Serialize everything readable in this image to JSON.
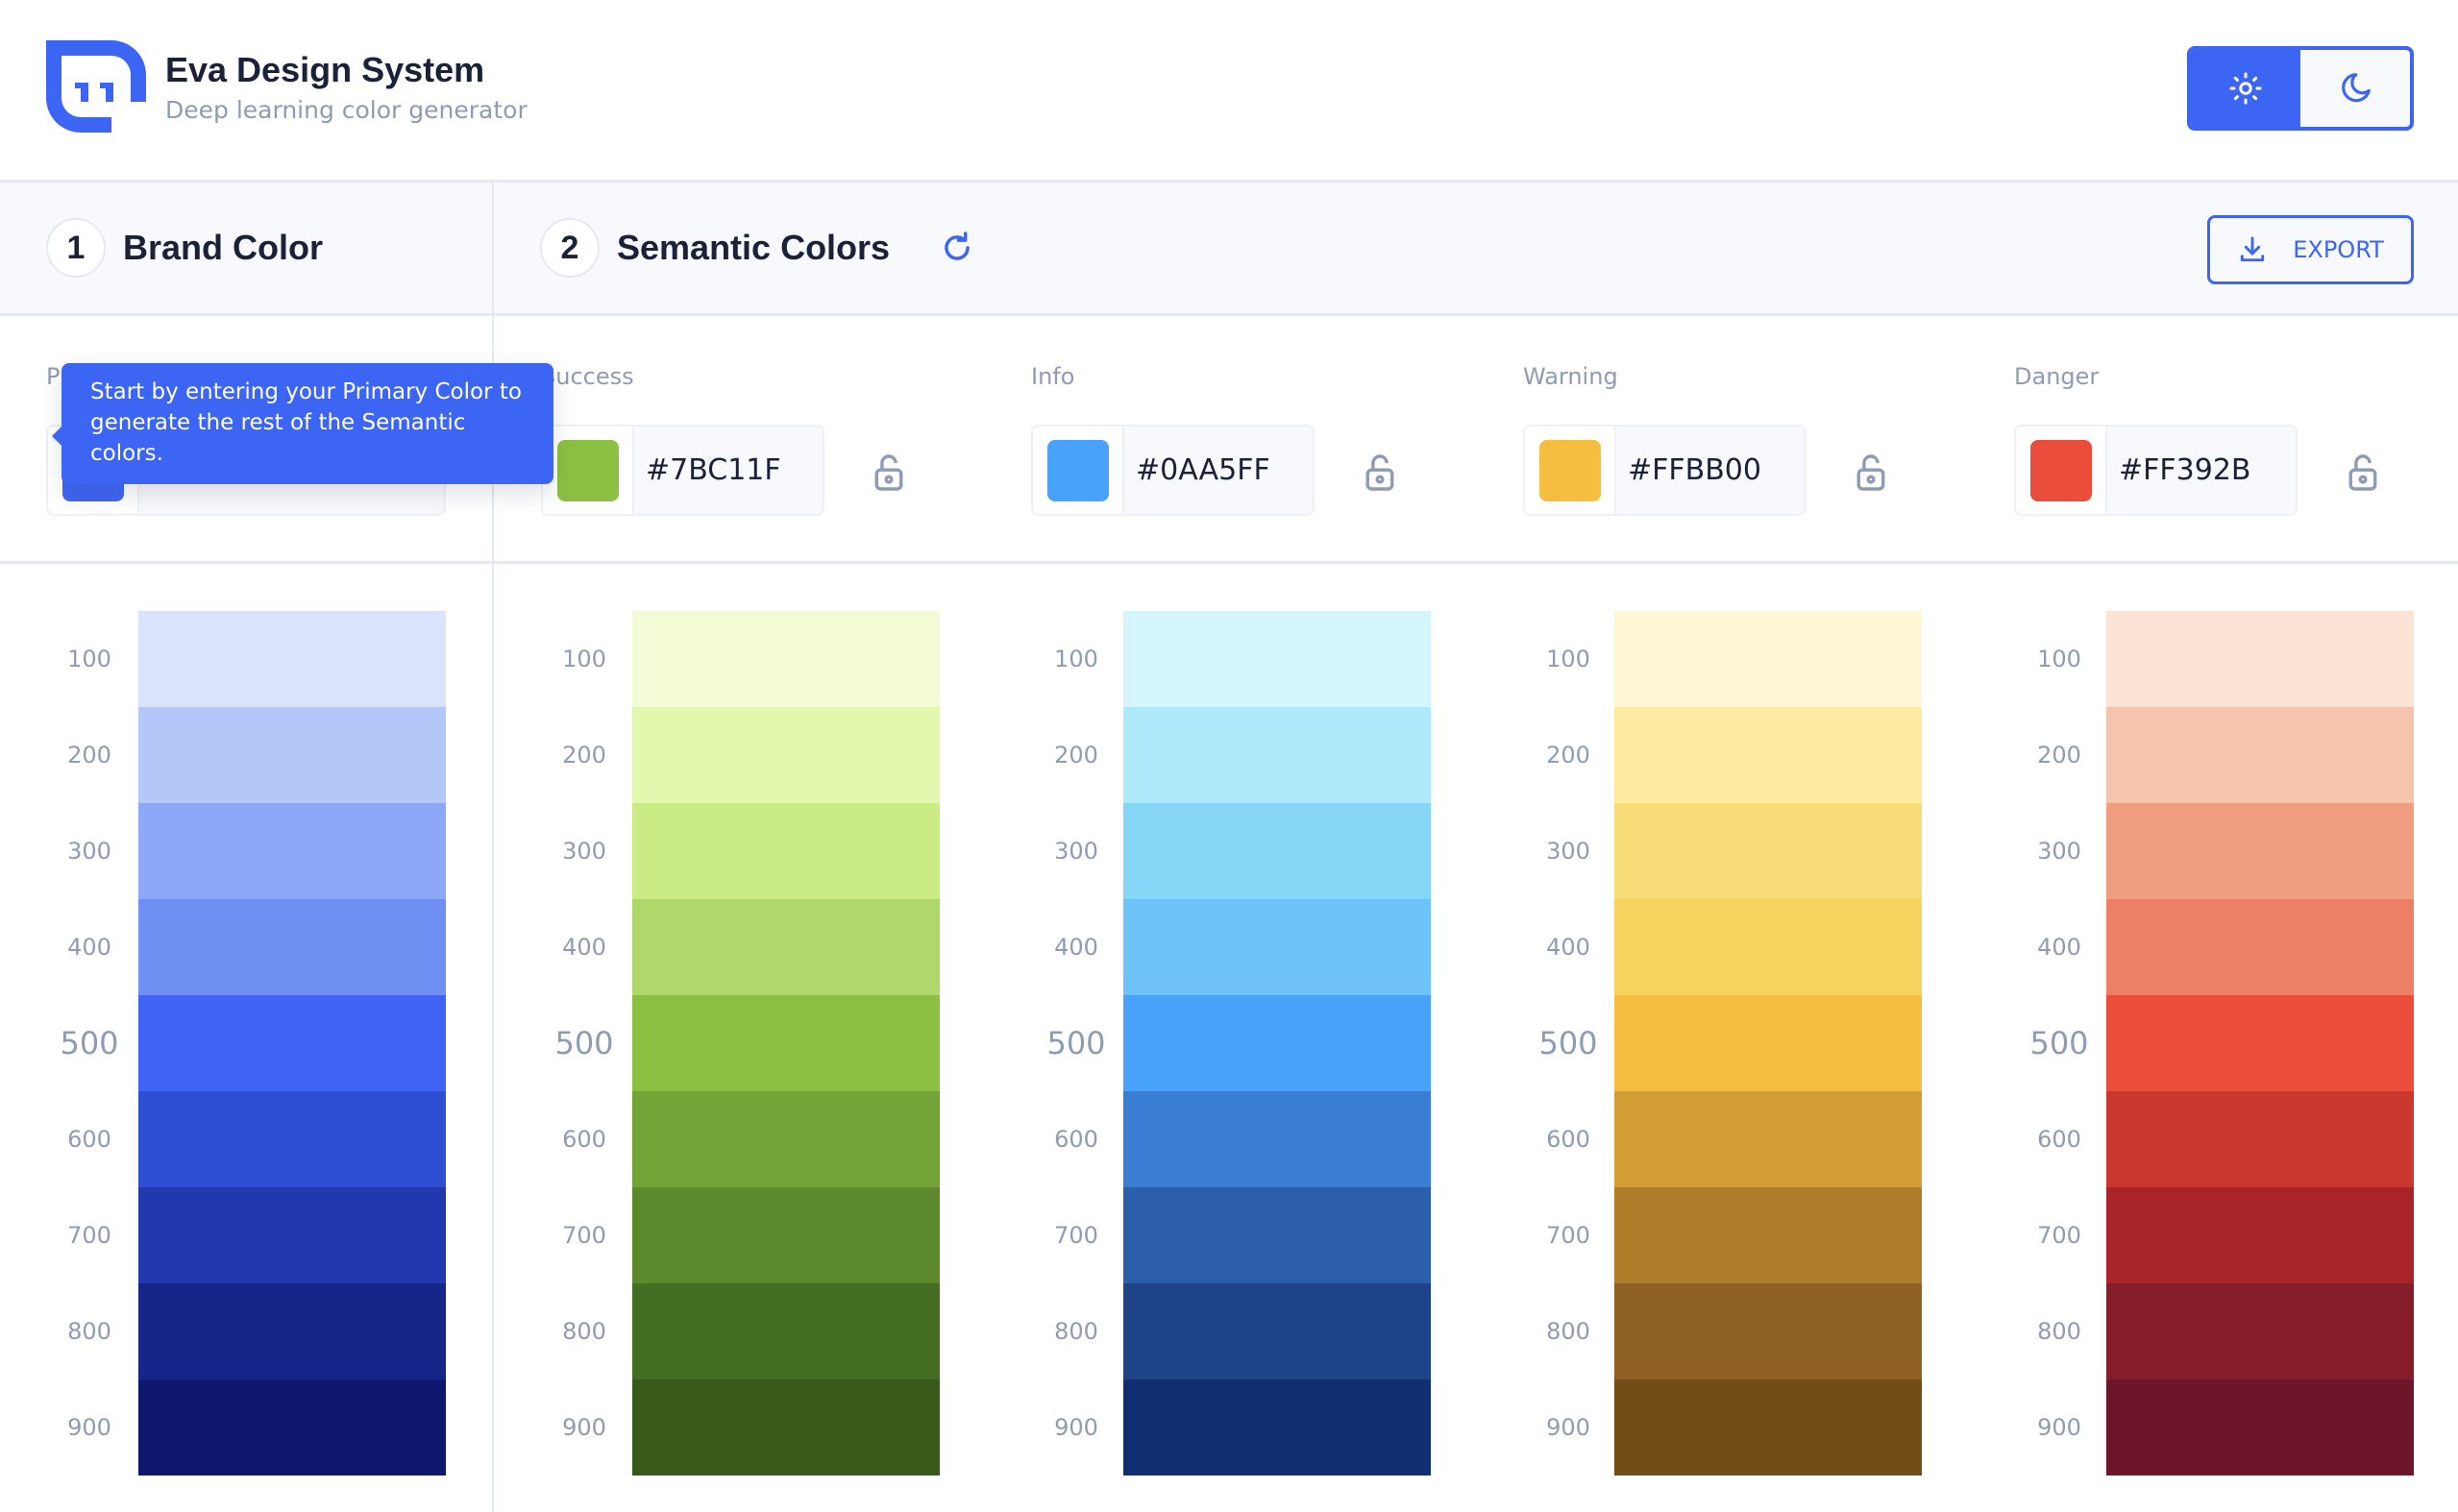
{
  "app": {
    "title": "Eva Design System",
    "subtitle": "Deep learning color generator"
  },
  "theme_toggle": {
    "options": [
      {
        "icon": "sun-icon",
        "label": "Light",
        "active": true
      },
      {
        "icon": "moon-icon",
        "label": "Dark",
        "active": false
      }
    ]
  },
  "sections": {
    "brand": {
      "number": "1",
      "title": "Brand Color"
    },
    "semantic": {
      "number": "2",
      "title": "Semantic Colors",
      "refresh_icon": "refresh-icon"
    }
  },
  "export": {
    "label": "EXPORT",
    "icon": "download-icon"
  },
  "tooltip": {
    "text": "Start by entering your Primary Color to generate the rest of the Semantic colors."
  },
  "inputs": {
    "primary": {
      "label": "Primary",
      "value": "",
      "color": "#3366FF"
    },
    "success": {
      "label": "Success",
      "value": "#7BC11F",
      "color": "#8BC043",
      "lock_icon": "unlock-icon"
    },
    "info": {
      "label": "Info",
      "value": "#0AA5FF",
      "color": "#49A2FA",
      "lock_icon": "unlock-icon"
    },
    "warning": {
      "label": "Warning",
      "value": "#FFBB00",
      "color": "#F5BE41",
      "lock_icon": "unlock-icon"
    },
    "danger": {
      "label": "Danger",
      "value": "#FF392B",
      "color": "#EA4D3A",
      "lock_icon": "unlock-icon"
    }
  },
  "shade_labels": [
    "100",
    "200",
    "300",
    "400",
    "500",
    "600",
    "700",
    "800",
    "900"
  ],
  "palettes": {
    "primary": [
      "#D9E4FC",
      "#B3C8F9",
      "#8CA8F6",
      "#6F8FF2",
      "#3F63F2",
      "#2E4ED3",
      "#2138AE",
      "#162588",
      "#0E186F"
    ],
    "success": [
      "#F2FAD6",
      "#E3F7AF",
      "#CBEB84",
      "#AFD86A",
      "#8BC043",
      "#73A437",
      "#5B892C",
      "#436E22",
      "#375A1B"
    ],
    "info": [
      "#D6F6FE",
      "#AEEAFC",
      "#86D6F8",
      "#6DC3F8",
      "#49A2FA",
      "#3A7ED3",
      "#2B5EAB",
      "#1E4389",
      "#122E72"
    ],
    "warning": [
      "#FEF6D4",
      "#FDEBA1",
      "#F8DC77",
      "#F6D25E",
      "#F5BE41",
      "#D19D34",
      "#AF7D29",
      "#8E6021",
      "#724D18"
    ],
    "danger": [
      "#FBE3D6",
      "#F4C4AD",
      "#EE9E7F",
      "#EB8066",
      "#EA4D3A",
      "#C9372E",
      "#A82429",
      "#851D2B",
      "#6D1629"
    ]
  }
}
